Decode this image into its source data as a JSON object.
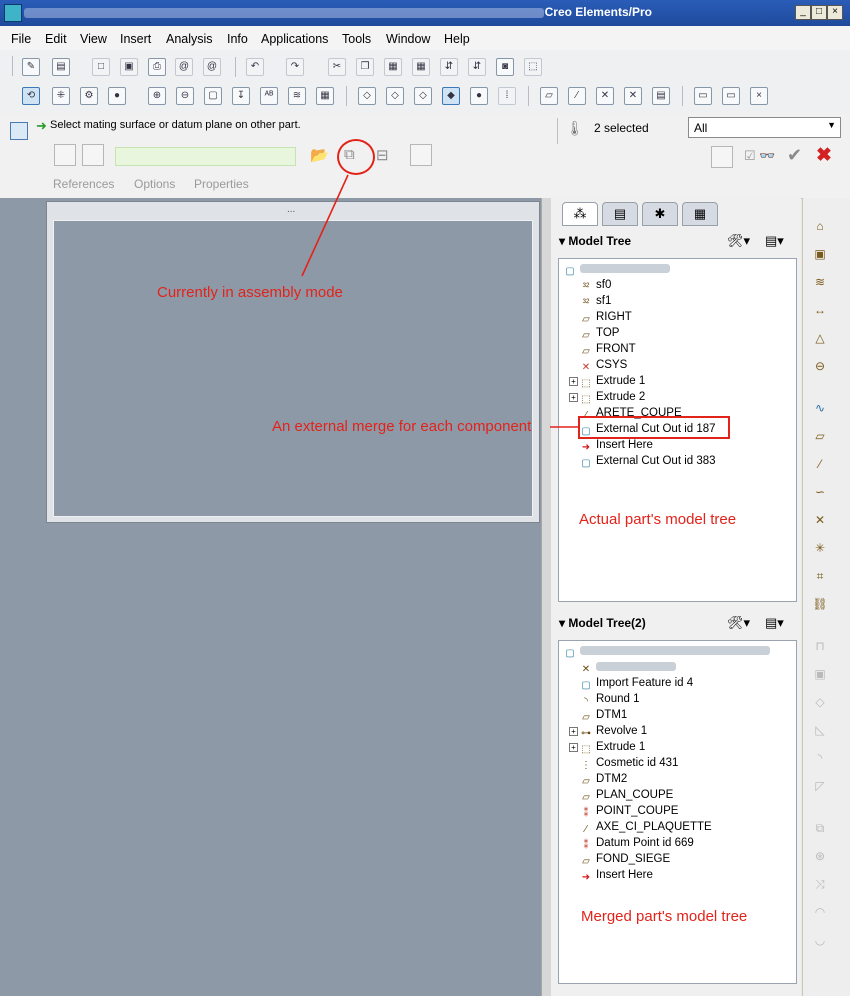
{
  "window": {
    "title": "Creo Elements/Pro"
  },
  "menubar": [
    "File",
    "Edit",
    "View",
    "Insert",
    "Analysis",
    "Info",
    "Applications",
    "Tools",
    "Window",
    "Help"
  ],
  "dashboard": {
    "prompt": "Select mating surface or datum plane on other part.",
    "selected": "2 selected",
    "filter": "All",
    "tabs": [
      "References",
      "Options",
      "Properties"
    ]
  },
  "model_tree_1": {
    "header": "Model Tree",
    "items": [
      {
        "label": "sf0",
        "icon": "sketch-icon"
      },
      {
        "label": "sf1",
        "icon": "sketch-icon"
      },
      {
        "label": "RIGHT",
        "icon": "datum-plane-icon"
      },
      {
        "label": "TOP",
        "icon": "datum-plane-icon"
      },
      {
        "label": "FRONT",
        "icon": "datum-plane-icon"
      },
      {
        "label": "CSYS",
        "icon": "csys-icon"
      },
      {
        "label": "Extrude 1",
        "icon": "extrude-icon"
      },
      {
        "label": "Extrude 2",
        "icon": "extrude-icon"
      },
      {
        "label": "ARETE_COUPE",
        "icon": "datum-axis-icon"
      },
      {
        "label": "External Cut Out id 187",
        "icon": "external-cut-icon"
      },
      {
        "label": "Insert Here",
        "icon": "insert-arrow-icon"
      },
      {
        "label": "External Cut Out id 383",
        "icon": "external-cut-icon"
      }
    ]
  },
  "model_tree_2": {
    "header": "Model Tree(2)",
    "items": [
      {
        "label": "Import Feature id 4",
        "icon": "import-feature-icon"
      },
      {
        "label": "Round 1",
        "icon": "round-icon"
      },
      {
        "label": "DTM1",
        "icon": "datum-plane-icon"
      },
      {
        "label": "Revolve 1",
        "icon": "revolve-icon"
      },
      {
        "label": "Extrude 1",
        "icon": "extrude-icon"
      },
      {
        "label": "Cosmetic id 431",
        "icon": "cosmetic-icon"
      },
      {
        "label": "DTM2",
        "icon": "datum-plane-icon"
      },
      {
        "label": "PLAN_COUPE",
        "icon": "datum-plane-icon"
      },
      {
        "label": "POINT_COUPE",
        "icon": "datum-point-icon"
      },
      {
        "label": "AXE_CI_PLAQUETTE",
        "icon": "datum-axis-icon"
      },
      {
        "label": "Datum Point id 669",
        "icon": "datum-point-icon"
      },
      {
        "label": "FOND_SIEGE",
        "icon": "datum-plane-icon"
      },
      {
        "label": "Insert Here",
        "icon": "insert-arrow-icon"
      }
    ]
  },
  "annotations": {
    "assembly_mode": "Currently in assembly mode",
    "external_merge": "An external merge for each component",
    "actual_tree": "Actual part's model tree",
    "merged_tree": "Merged part's model tree"
  },
  "colors": {
    "annotation": "#e2231a",
    "graphics_bg": "#8e99a8",
    "titlebar": "#2a5db8"
  }
}
